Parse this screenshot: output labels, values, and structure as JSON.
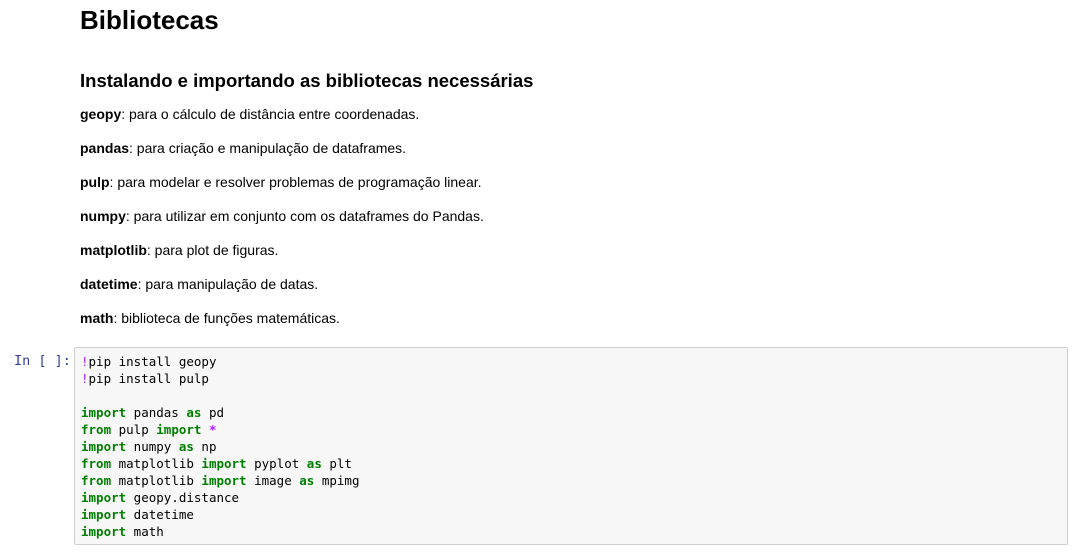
{
  "markdown": {
    "title": "Bibliotecas",
    "subtitle": "Instalando e importando as bibliotecas necessárias",
    "libraries": [
      {
        "name": "geopy",
        "desc": ": para o cálculo de distância entre coordenadas."
      },
      {
        "name": "pandas",
        "desc": ": para criação e manipulação de dataframes."
      },
      {
        "name": "pulp",
        "desc": ": para modelar e resolver problemas de programação linear."
      },
      {
        "name": "numpy",
        "desc": ": para utilizar em conjunto com os dataframes do Pandas."
      },
      {
        "name": "matplotlib",
        "desc": ": para plot de figuras."
      },
      {
        "name": "datetime",
        "desc": ": para manipulação de datas."
      },
      {
        "name": "math",
        "desc": ": biblioteca de funções matemáticas."
      }
    ]
  },
  "code_cell": {
    "prompt": "In [ ]:",
    "lines": [
      [
        {
          "t": "!",
          "c": "bang"
        },
        {
          "t": "pip install geopy"
        }
      ],
      [
        {
          "t": "!",
          "c": "bang"
        },
        {
          "t": "pip install pulp"
        }
      ],
      [],
      [
        {
          "t": "import",
          "c": "kw"
        },
        {
          "t": " pandas "
        },
        {
          "t": "as",
          "c": "kw"
        },
        {
          "t": " pd"
        }
      ],
      [
        {
          "t": "from",
          "c": "kw"
        },
        {
          "t": " pulp "
        },
        {
          "t": "import",
          "c": "kw"
        },
        {
          "t": " "
        },
        {
          "t": "*",
          "c": "star"
        }
      ],
      [
        {
          "t": "import",
          "c": "kw"
        },
        {
          "t": " numpy "
        },
        {
          "t": "as",
          "c": "kw"
        },
        {
          "t": " np"
        }
      ],
      [
        {
          "t": "from",
          "c": "kw"
        },
        {
          "t": " matplotlib "
        },
        {
          "t": "import",
          "c": "kw"
        },
        {
          "t": " pyplot "
        },
        {
          "t": "as",
          "c": "kw"
        },
        {
          "t": " plt"
        }
      ],
      [
        {
          "t": "from",
          "c": "kw"
        },
        {
          "t": " matplotlib "
        },
        {
          "t": "import",
          "c": "kw"
        },
        {
          "t": " image "
        },
        {
          "t": "as",
          "c": "kw"
        },
        {
          "t": " mpimg"
        }
      ],
      [
        {
          "t": "import",
          "c": "kw"
        },
        {
          "t": " geopy.distance"
        }
      ],
      [
        {
          "t": "import",
          "c": "kw"
        },
        {
          "t": " datetime"
        }
      ],
      [
        {
          "t": "import",
          "c": "kw"
        },
        {
          "t": " math"
        }
      ]
    ]
  },
  "colors": {
    "prompt": "#303f9f",
    "keyword": "#008000",
    "operator": "#aa22ff",
    "code_background": "#f7f7f7",
    "code_border": "#cfcfcf"
  }
}
